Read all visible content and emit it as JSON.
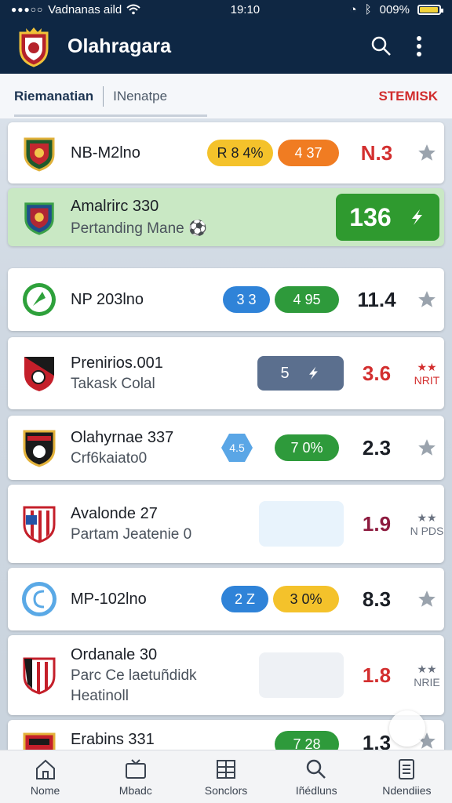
{
  "status_bar": {
    "carrier": "Vadnanas aild",
    "time": "19:10",
    "battery": "009%",
    "battery_level": 0.9
  },
  "app_bar": {
    "title": "Olahragara",
    "icons": [
      "search-icon",
      "more-vert-icon"
    ]
  },
  "filter_bar": {
    "tab_active": "Riemanatian",
    "tab_inactive": "INenatpe",
    "right_label": "STEMISK"
  },
  "colors": {
    "header_bg": "#0e2744",
    "accent_red": "#d32f2f",
    "green": "#2e9a3b",
    "yellow": "#f4c22b",
    "orange": "#f07c22",
    "blue": "#2f83d8"
  },
  "matches": [
    {
      "name": "NB-M2lno",
      "pill1": "R 8 4%",
      "pill2": "4 37",
      "score": "N.3"
    },
    {
      "name": "Amalrirc 330",
      "sub": "Pertanding Mane",
      "value": "136"
    },
    {
      "name": "NP 203lno",
      "pill1": "3 3",
      "pill2": "4 95",
      "score": "11.4"
    },
    {
      "name": "Prenirios.001",
      "sub": "Takask Colal",
      "box": "5",
      "score": "3.6",
      "side": "NRIT"
    },
    {
      "name": "Olahyrnae 337",
      "sub": "Crf6kaiato0",
      "hex": "4.5",
      "pill2": "7 0%",
      "score": "2.3"
    },
    {
      "name": "Avalonde 27",
      "sub": "Partam Jeatenie 0",
      "score": "1.9",
      "side": "N PDS"
    },
    {
      "name": "MP-102lno",
      "pill1": "2 Z",
      "pill2": "3 0%",
      "score": "8.3"
    },
    {
      "name": "Ordanale 30",
      "sub": "Parc Ce laetuñdidk",
      "sub2": "Heatinoll",
      "score": "1.8",
      "side": "NRIE"
    },
    {
      "name": "Erabins 331",
      "pill2": "7 28",
      "score": "1.3"
    }
  ],
  "bottom_nav": [
    {
      "label": "Nome",
      "icon": "home-icon"
    },
    {
      "label": "Mbadc",
      "icon": "tv-icon"
    },
    {
      "label": "Sonclors",
      "icon": "grid-icon"
    },
    {
      "label": "Iñédluns",
      "icon": "search-icon"
    },
    {
      "label": "Ndendiies",
      "icon": "document-icon"
    }
  ]
}
